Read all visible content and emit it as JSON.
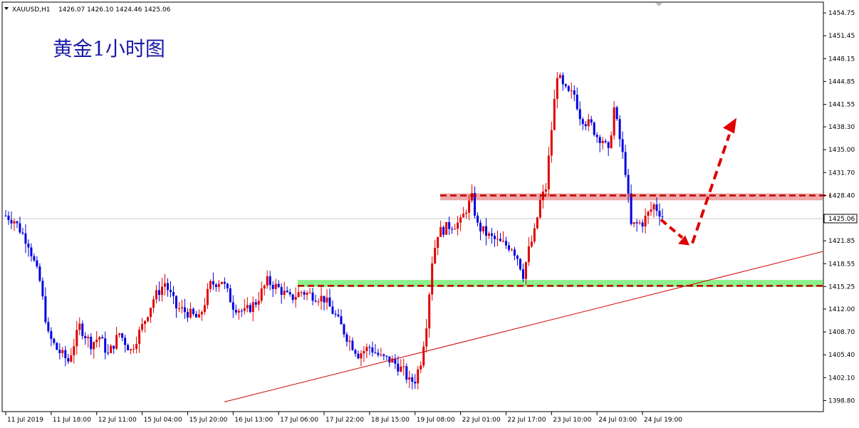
{
  "header": {
    "symbol": "XAUUSD,H1",
    "ohlc": "1426.07 1426.10 1424.46 1425.06"
  },
  "chart_data": {
    "type": "candlestick",
    "title": "黄金1小时图",
    "ylim": [
      1397.3,
      1456.2
    ],
    "yticks": [
      "1454.75",
      "1451.45",
      "1448.15",
      "1444.85",
      "1441.55",
      "1438.30",
      "1435.00",
      "1431.70",
      "1428.40",
      "1425.06",
      "1421.85",
      "1418.55",
      "1415.25",
      "1412.00",
      "1408.70",
      "1405.40",
      "1402.10",
      "1398.80"
    ],
    "current_price": "1425.06",
    "xticks": [
      "11 Jul 2019",
      "11 Jul 18:00",
      "12 Jul 11:00",
      "15 Jul 04:00",
      "15 Jul 20:00",
      "16 Jul 13:00",
      "17 Jul 06:00",
      "17 Jul 22:00",
      "18 Jul 15:00",
      "19 Jul 08:00",
      "22 Jul 01:00",
      "22 Jul 17:00",
      "23 Jul 10:00",
      "24 Jul 03:00",
      "24 Jul 19:00"
    ],
    "num_bars": 232,
    "path_points": [
      [
        0,
        1425.5
      ],
      [
        3,
        1424.8
      ],
      [
        8,
        1421.5
      ],
      [
        12,
        1416.0
      ],
      [
        15,
        1408.2
      ],
      [
        18,
        1406.2
      ],
      [
        22,
        1404.5
      ],
      [
        26,
        1409.5
      ],
      [
        30,
        1407.0
      ],
      [
        33,
        1408.0
      ],
      [
        36,
        1405.4
      ],
      [
        40,
        1408.5
      ],
      [
        44,
        1406.0
      ],
      [
        48,
        1409.5
      ],
      [
        52,
        1413.5
      ],
      [
        56,
        1415.8
      ],
      [
        60,
        1412.2
      ],
      [
        64,
        1411.5
      ],
      [
        68,
        1410.5
      ],
      [
        72,
        1415.5
      ],
      [
        76,
        1416.2
      ],
      [
        80,
        1412.5
      ],
      [
        84,
        1411.5
      ],
      [
        88,
        1413.0
      ],
      [
        92,
        1416.0
      ],
      [
        96,
        1415.0
      ],
      [
        100,
        1413.5
      ],
      [
        104,
        1414.5
      ],
      [
        108,
        1414.0
      ],
      [
        112,
        1413.5
      ],
      [
        116,
        1411.0
      ],
      [
        120,
        1408.0
      ],
      [
        124,
        1405.5
      ],
      [
        128,
        1406.5
      ],
      [
        132,
        1405.0
      ],
      [
        136,
        1404.5
      ],
      [
        140,
        1403.0
      ],
      [
        142,
        1401.5
      ],
      [
        144,
        1401.8
      ],
      [
        146,
        1404.5
      ],
      [
        148,
        1410.0
      ],
      [
        150,
        1419.0
      ],
      [
        152,
        1423.0
      ],
      [
        156,
        1424.0
      ],
      [
        160,
        1424.5
      ],
      [
        162,
        1426.5
      ],
      [
        164,
        1428.0
      ],
      [
        166,
        1424.0
      ],
      [
        170,
        1422.5
      ],
      [
        174,
        1421.5
      ],
      [
        178,
        1421.0
      ],
      [
        180,
        1419.5
      ],
      [
        182,
        1417.0
      ],
      [
        184,
        1420.5
      ],
      [
        186,
        1423.0
      ],
      [
        188,
        1427.5
      ],
      [
        190,
        1429.5
      ],
      [
        192,
        1438.0
      ],
      [
        194,
        1446.0
      ],
      [
        196,
        1444.0
      ],
      [
        198,
        1443.0
      ],
      [
        200,
        1443.0
      ],
      [
        202,
        1440.0
      ],
      [
        204,
        1439.0
      ],
      [
        206,
        1438.5
      ],
      [
        208,
        1437.0
      ],
      [
        210,
        1436.5
      ],
      [
        212,
        1434.5
      ],
      [
        214,
        1441.0
      ]
    ],
    "annotations": {
      "resistance_zone": [
        1427.7,
        1428.7
      ],
      "resistance_line": 1428.4,
      "support_zone": [
        1415.2,
        1416.2
      ],
      "support_line": 1415.35,
      "trendline": [
        [
          1398.6,
          1420.3
        ]
      ]
    }
  },
  "colors": {
    "bull": "#e00000",
    "bear": "#0000e0",
    "trendline": "#d40000",
    "resistance": "#e06060",
    "support": "#7ef07e",
    "arrow": "#e00000",
    "title": "#1a1aa6"
  }
}
